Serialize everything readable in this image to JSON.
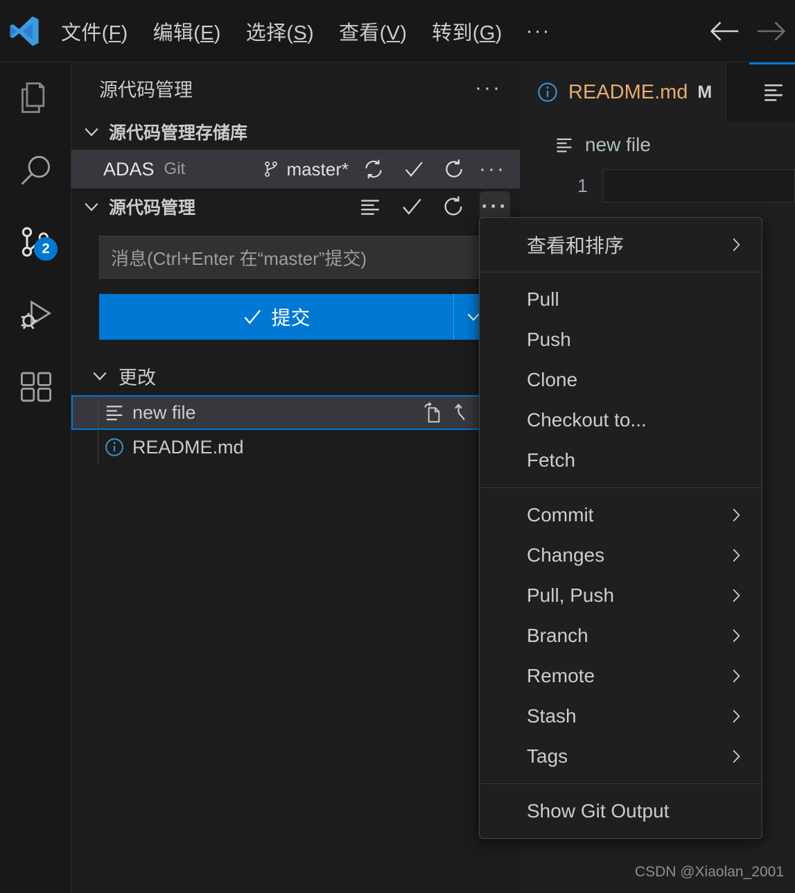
{
  "window": {
    "logo_icon": "vscode-logo-icon",
    "menus": [
      {
        "label": "文件",
        "mnemonic": "F"
      },
      {
        "label": "编辑",
        "mnemonic": "E"
      },
      {
        "label": "选择",
        "mnemonic": "S"
      },
      {
        "label": "查看",
        "mnemonic": "V"
      },
      {
        "label": "转到",
        "mnemonic": "G"
      }
    ],
    "more_label": "···",
    "nav_back_icon": "arrow-left-icon",
    "nav_forward_icon": "arrow-right-icon"
  },
  "activity_bar": {
    "items": [
      {
        "name": "explorer",
        "icon": "files-icon",
        "badge": ""
      },
      {
        "name": "search",
        "icon": "search-icon",
        "badge": ""
      },
      {
        "name": "source-control",
        "icon": "source-control-icon",
        "badge": "2"
      },
      {
        "name": "run-and-debug",
        "icon": "run-debug-icon",
        "badge": ""
      },
      {
        "name": "extensions",
        "icon": "extensions-icon",
        "badge": ""
      }
    ]
  },
  "sidebar": {
    "title": "源代码管理",
    "title_more_label": "···",
    "repositories_section": {
      "label": "源代码管理存储库",
      "chevron": "chevron-down-icon",
      "repo": {
        "name": "ADAS",
        "kind": "Git",
        "branch": "master*",
        "branch_icon": "git-branch-icon",
        "actions": [
          {
            "name": "sync-changes",
            "icon": "sync-icon"
          },
          {
            "name": "commit",
            "icon": "check-icon"
          },
          {
            "name": "refresh",
            "icon": "refresh-icon"
          },
          {
            "name": "more-actions",
            "icon": "kebab-icon",
            "label": "···"
          }
        ]
      }
    },
    "scm_section": {
      "label": "源代码管理",
      "chevron": "chevron-down-icon",
      "actions": [
        {
          "name": "view-as-list",
          "icon": "list-icon"
        },
        {
          "name": "commit",
          "icon": "check-icon"
        },
        {
          "name": "refresh",
          "icon": "refresh-icon"
        },
        {
          "name": "views-and-more-actions",
          "icon": "kebab-icon",
          "label": "···"
        }
      ]
    },
    "commit_message": {
      "value": "",
      "placeholder": "消息(Ctrl+Enter 在“master”提交)"
    },
    "commit_button": {
      "label": "提交",
      "icon": "check-icon",
      "dropdown_icon": "chevron-down-icon",
      "color": "#0078d4"
    },
    "changes_group": {
      "label": "更改",
      "chevron": "chevron-down-icon",
      "files": [
        {
          "name": "new file",
          "icon": "diff-lines-icon",
          "selected": true,
          "actions": [
            {
              "name": "open-file",
              "icon": "open-file-icon"
            },
            {
              "name": "discard-changes",
              "icon": "discard-icon"
            },
            {
              "name": "stage-changes",
              "icon": "plus-icon"
            }
          ]
        },
        {
          "name": "README.md",
          "icon": "info-circle-icon",
          "selected": false,
          "actions": []
        }
      ]
    }
  },
  "context_menu": {
    "groups": [
      {
        "items": [
          {
            "label": "查看和排序",
            "submenu": true
          }
        ]
      },
      {
        "items": [
          {
            "label": "Pull",
            "submenu": false
          },
          {
            "label": "Push",
            "submenu": false
          },
          {
            "label": "Clone",
            "submenu": false
          },
          {
            "label": "Checkout to...",
            "submenu": false
          },
          {
            "label": "Fetch",
            "submenu": false
          }
        ]
      },
      {
        "items": [
          {
            "label": "Commit",
            "submenu": true
          },
          {
            "label": "Changes",
            "submenu": true
          },
          {
            "label": "Pull, Push",
            "submenu": true
          },
          {
            "label": "Branch",
            "submenu": true
          },
          {
            "label": "Remote",
            "submenu": true
          },
          {
            "label": "Stash",
            "submenu": true
          },
          {
            "label": "Tags",
            "submenu": true
          }
        ]
      },
      {
        "items": [
          {
            "label": "Show Git Output",
            "submenu": false
          }
        ]
      }
    ]
  },
  "editor": {
    "tab": {
      "label": "README.md",
      "icon": "info-circle-icon",
      "dirty_badge": "M"
    },
    "tabbar_action": {
      "name": "open-changes",
      "icon": "diff-lines-icon"
    },
    "diff_title": "new file",
    "diff_title_icon": "diff-lines-icon",
    "line_numbers": [
      "1"
    ]
  },
  "watermark": "CSDN @Xiaolan_2001",
  "colors": {
    "accent": "#0078d4",
    "tab_foreground": "#e8ab6f",
    "titlebar_bg": "#181818",
    "sidebar_bg": "#1c1c1c",
    "editor_bg": "#1f1f1f",
    "menu_bg": "#1f1f1f",
    "selection_bg": "#37373d"
  }
}
